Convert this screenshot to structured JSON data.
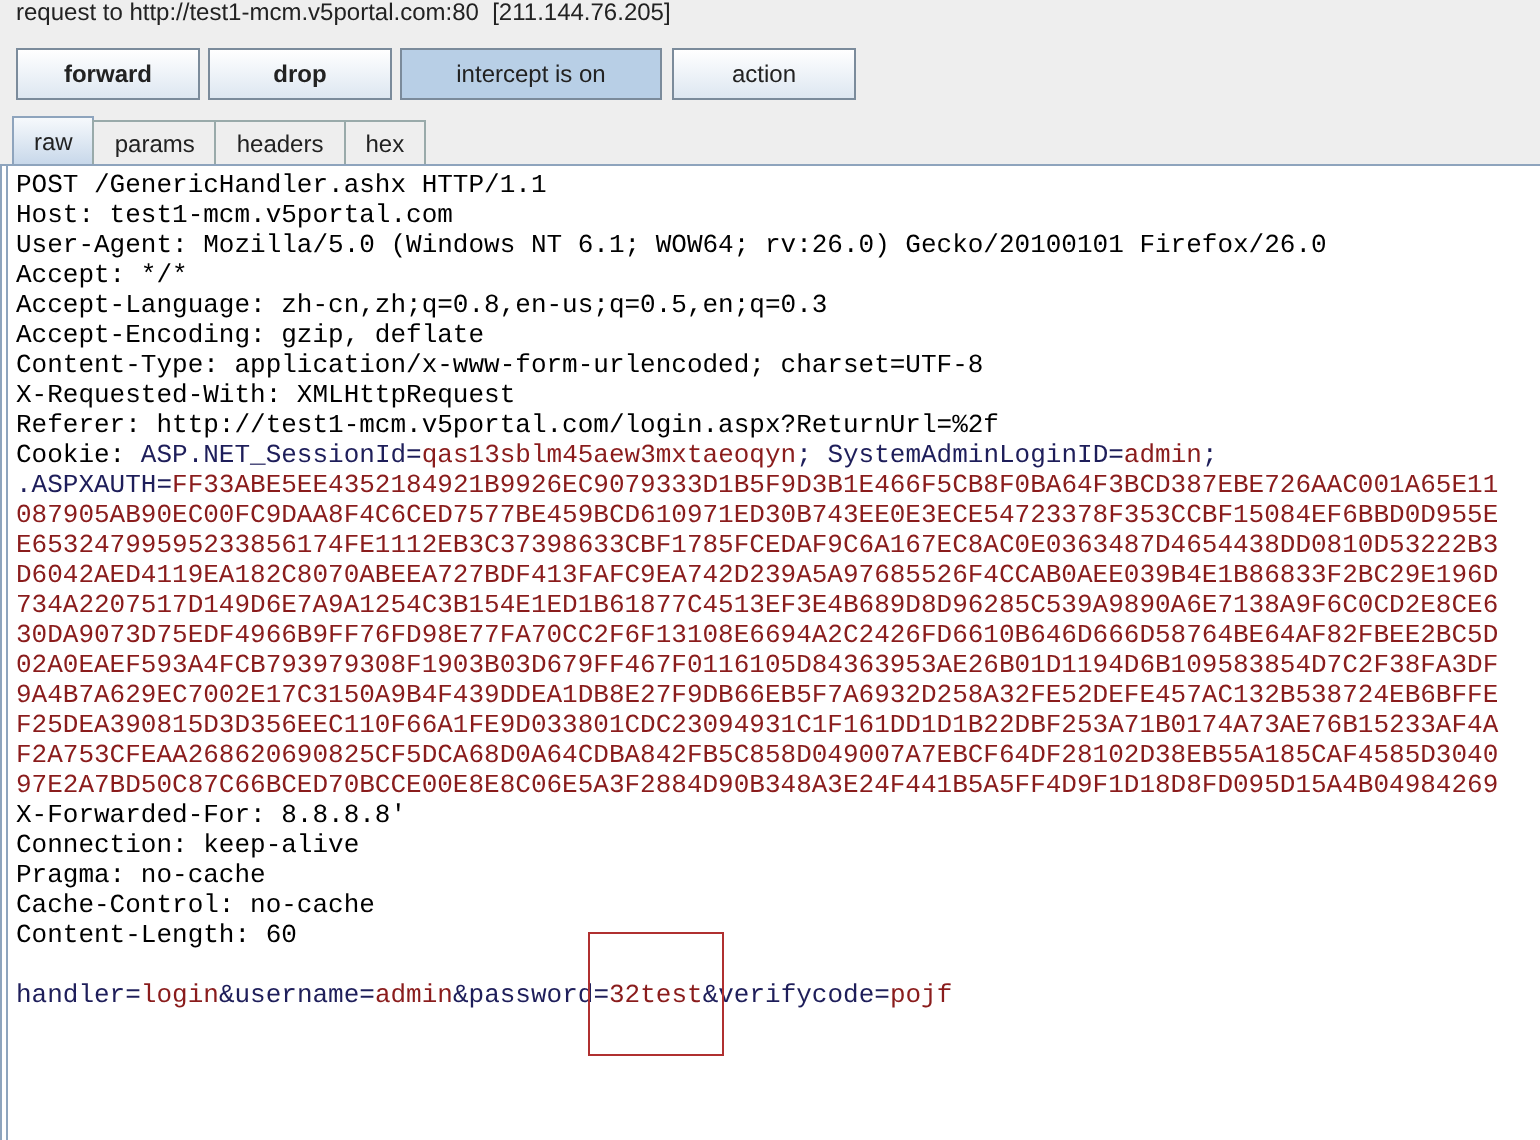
{
  "title": "request to http://test1-mcm.v5portal.com:80  [211.144.76.205]",
  "buttons": [
    {
      "label": "forward",
      "bold": true,
      "pressed": false
    },
    {
      "label": "drop",
      "bold": true,
      "pressed": false
    },
    {
      "label": "intercept is on",
      "bold": false,
      "pressed": true
    },
    {
      "label": "action",
      "bold": false,
      "pressed": false
    }
  ],
  "tabs": [
    {
      "label": "raw",
      "selected": true
    },
    {
      "label": "params",
      "selected": false
    },
    {
      "label": "headers",
      "selected": false
    },
    {
      "label": "hex",
      "selected": false
    }
  ],
  "lines": [
    {
      "segments": [
        {
          "text": "POST /GenericHandler.ashx HTTP/1.1",
          "kind": "plain"
        }
      ]
    },
    {
      "segments": [
        {
          "text": "Host: test1-mcm.v5portal.com",
          "kind": "plain"
        }
      ]
    },
    {
      "segments": [
        {
          "text": "User-Agent: Mozilla/5.0 (Windows NT 6.1; WOW64; rv:26.0) Gecko/20100101 Firefox/26.0",
          "kind": "plain"
        }
      ]
    },
    {
      "segments": [
        {
          "text": "Accept: */*",
          "kind": "plain"
        }
      ]
    },
    {
      "segments": [
        {
          "text": "Accept-Language: zh-cn,zh;q=0.8,en-us;q=0.5,en;q=0.3",
          "kind": "plain"
        }
      ]
    },
    {
      "segments": [
        {
          "text": "Accept-Encoding: gzip, deflate",
          "kind": "plain"
        }
      ]
    },
    {
      "segments": [
        {
          "text": "Content-Type: application/x-www-form-urlencoded; charset=UTF-8",
          "kind": "plain"
        }
      ]
    },
    {
      "segments": [
        {
          "text": "X-Requested-With: XMLHttpRequest",
          "kind": "plain"
        }
      ]
    },
    {
      "segments": [
        {
          "text": "Referer: http://test1-mcm.v5portal.com/login.aspx?ReturnUrl=%2f",
          "kind": "plain"
        }
      ]
    },
    {
      "segments": [
        {
          "text": "Cookie: ",
          "kind": "plain"
        },
        {
          "text": "ASP.NET_SessionId=",
          "kind": "name"
        },
        {
          "text": "qas13sblm45aew3mxtaeoqyn",
          "kind": "value"
        },
        {
          "text": "; SystemAdminLoginID=",
          "kind": "name"
        },
        {
          "text": "admin",
          "kind": "value"
        },
        {
          "text": ";",
          "kind": "name"
        }
      ]
    },
    {
      "segments": [
        {
          "text": ".ASPXAUTH=",
          "kind": "name"
        },
        {
          "text": "FF33ABE5EE4352184921B9926EC9079333D1B5F9D3B1E466F5CB8F0BA64F3BCD387EBE726AAC001A65E11",
          "kind": "value"
        }
      ]
    },
    {
      "segments": [
        {
          "text": "087905AB90EC00FC9DAA8F4C6CED7577BE459BCD610971ED30B743EE0E3ECE54723378F353CCBF15084EF6BBD0D955E",
          "kind": "value"
        }
      ]
    },
    {
      "segments": [
        {
          "text": "E65324799595233856174FE1112EB3C37398633CBF1785FCEDAF9C6A167EC8AC0E0363487D4654438DD0810D53222B3",
          "kind": "value"
        }
      ]
    },
    {
      "segments": [
        {
          "text": "D6042AED4119EA182C8070ABEEA727BDF413FAFC9EA742D239A5A97685526F4CCAB0AEE039B4E1B86833F2BC29E196D",
          "kind": "value"
        }
      ]
    },
    {
      "segments": [
        {
          "text": "734A2207517D149D6E7A9A1254C3B154E1ED1B61877C4513EF3E4B689D8D96285C539A9890A6E7138A9F6C0CD2E8CE6",
          "kind": "value"
        }
      ]
    },
    {
      "segments": [
        {
          "text": "30DA9073D75EDF4966B9FF76FD98E77FA70CC2F6F13108E6694A2C2426FD6610B646D666D58764BE64AF82FBEE2BC5D",
          "kind": "value"
        }
      ]
    },
    {
      "segments": [
        {
          "text": "02A0EAEF593A4FCB793979308F1903B03D679FF467F0116105D84363953AE26B01D1194D6B109583854D7C2F38FA3DF",
          "kind": "value"
        }
      ]
    },
    {
      "segments": [
        {
          "text": "9A4B7A629EC7002E17C3150A9B4F439DDEA1DB8E27F9DB66EB5F7A6932D258A32FE52DEFE457AC132B538724EB6BFFE",
          "kind": "value"
        }
      ]
    },
    {
      "segments": [
        {
          "text": "F25DEA390815D3D356EEC110F66A1FE9D033801CDC23094931C1F161DD1D1B22DBF253A71B0174A73AE76B15233AF4A",
          "kind": "value"
        }
      ]
    },
    {
      "segments": [
        {
          "text": "F2A753CFEAA268620690825CF5DCA68D0A64CDBA842FB5C858D049007A7EBCF64DF28102D38EB55A185CAF4585D3040",
          "kind": "value"
        }
      ]
    },
    {
      "segments": [
        {
          "text": "97E2A7BD50C87C66BCED70BCCE00E8E8C06E5A3F2884D90B348A3E24F441B5A5FF4D9F1D18D8FD095D15A4B04984269",
          "kind": "value"
        }
      ]
    },
    {
      "segments": [
        {
          "text": "X-Forwarded-For: 8.8.8.8'",
          "kind": "plain"
        }
      ]
    },
    {
      "segments": [
        {
          "text": "Connection: keep-alive",
          "kind": "plain"
        }
      ]
    },
    {
      "segments": [
        {
          "text": "Pragma: no-cache",
          "kind": "plain"
        }
      ]
    },
    {
      "segments": [
        {
          "text": "Cache-Control: no-cache",
          "kind": "plain"
        }
      ]
    },
    {
      "segments": [
        {
          "text": "Content-Length: 60",
          "kind": "plain"
        }
      ]
    }
  ],
  "body": {
    "before_box": [
      {
        "text": "handler=",
        "kind": "name"
      },
      {
        "text": "login",
        "kind": "value"
      },
      {
        "text": "&username=",
        "kind": "name"
      },
      {
        "text": "admin",
        "kind": "value"
      },
      {
        "text": "&password",
        "kind": "name"
      }
    ],
    "in_box": [
      {
        "text": "=",
        "kind": "name"
      },
      {
        "text": "32test",
        "kind": "value"
      },
      {
        "text": "&",
        "kind": "name"
      }
    ],
    "after_box": [
      {
        "text": "verifycode=",
        "kind": "name"
      },
      {
        "text": "pojf",
        "kind": "value"
      }
    ]
  }
}
